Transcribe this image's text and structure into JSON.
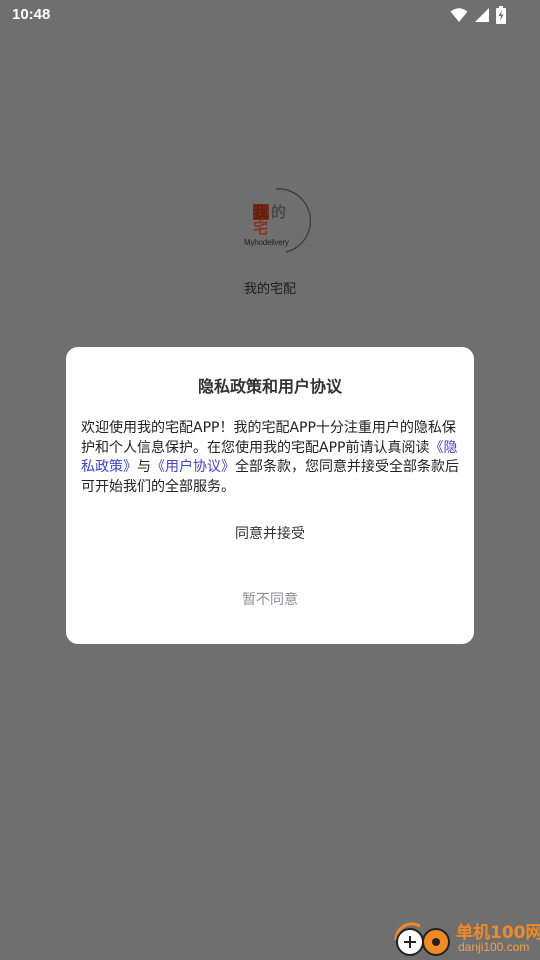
{
  "status_bar": {
    "time": "10:48",
    "icons": [
      "wifi-icon",
      "signal-icon",
      "battery-charging-icon"
    ]
  },
  "splash": {
    "logo_chars": [
      "我",
      "的",
      "宅"
    ],
    "logo_subtext": "Myhodelivery",
    "app_name": "我的宅配"
  },
  "dialog": {
    "title": "隐私政策和用户协议",
    "body": {
      "part1": "欢迎使用我的宅配APP！我的宅配APP十分注重用户的隐私保护和个人信息保护。在您使用我的宅配APP前请认真阅读",
      "privacy_link": "《隐私政策》",
      "joiner": "与",
      "agreement_link": "《用户协议》",
      "part2": "全部条款，您同意并接受全部条款后可开始我们的全部服务。"
    },
    "agree_label": "同意并接受",
    "disagree_label": "暂不同意"
  },
  "watermark": {
    "title": "单机100网",
    "url": "danji100.com"
  },
  "colors": {
    "overlay": "#6f6f6f",
    "link": "#3f43d6",
    "disagree": "#8e8e9a",
    "watermark": "#f08a24"
  }
}
